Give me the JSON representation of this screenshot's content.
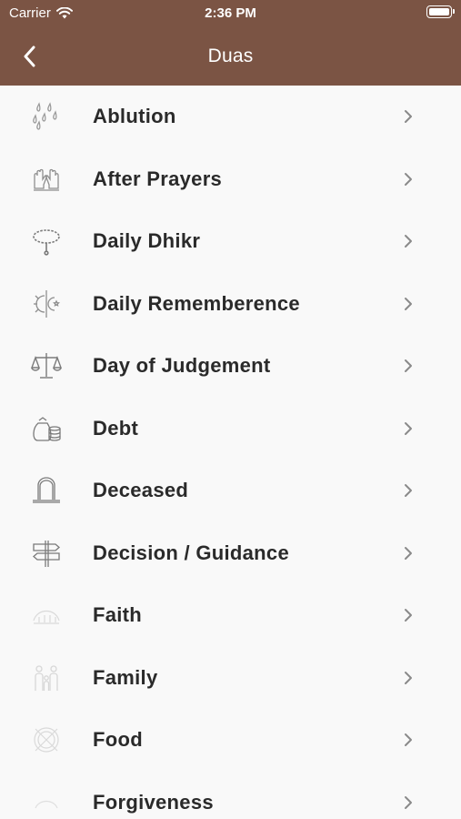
{
  "status_bar": {
    "carrier": "Carrier",
    "time": "2:36 PM"
  },
  "nav": {
    "title": "Duas"
  },
  "items": [
    {
      "label": "Ablution"
    },
    {
      "label": "After Prayers"
    },
    {
      "label": "Daily Dhikr"
    },
    {
      "label": "Daily Rememberence"
    },
    {
      "label": "Day of Judgement"
    },
    {
      "label": "Debt"
    },
    {
      "label": "Deceased"
    },
    {
      "label": "Decision / Guidance"
    },
    {
      "label": "Faith"
    },
    {
      "label": "Family"
    },
    {
      "label": "Food"
    },
    {
      "label": "Forgiveness"
    }
  ],
  "colors": {
    "nav_bar": "#7b5444",
    "background": "#f9f9f9",
    "text": "#2a2a2a",
    "chevron": "#8a8a8a"
  }
}
